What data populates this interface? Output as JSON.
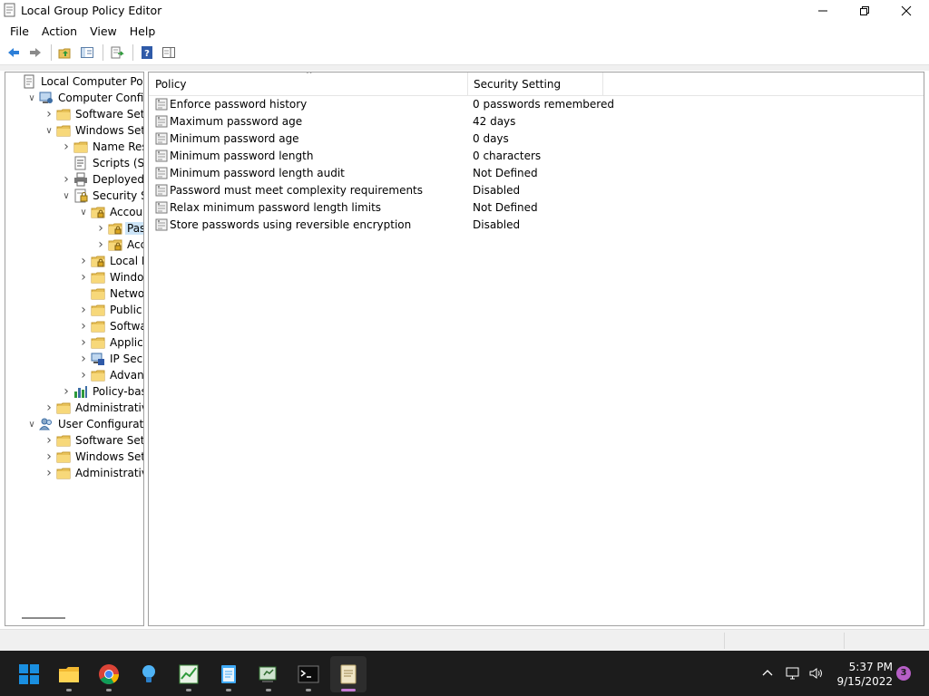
{
  "window": {
    "title": "Local Group Policy Editor",
    "controls": {
      "minimize_icon": "minimize-icon",
      "maximize_icon": "restore-icon",
      "close_icon": "close-icon"
    }
  },
  "menu": [
    "File",
    "Action",
    "View",
    "Help"
  ],
  "toolbar": {
    "buttons": [
      "back-icon",
      "forward-icon",
      "up-folder-icon",
      "show-hide-tree-icon",
      "export-list-icon",
      "help-icon",
      "show-hide-action-pane-icon"
    ]
  },
  "tree": {
    "items": [
      {
        "label": "Local Computer Policy",
        "twisty": "",
        "icon": "policy-doc-icon"
      },
      {
        "label": "Computer Configuration",
        "twisty": "expanded",
        "icon": "computer-icon"
      },
      {
        "label": "Software Settings",
        "twisty": "collapsed",
        "icon": "folder-icon"
      },
      {
        "label": "Windows Settings",
        "twisty": "expanded",
        "icon": "folder-icon"
      },
      {
        "label": "Name Resolution Policy",
        "twisty": "collapsed",
        "icon": "folder-icon"
      },
      {
        "label": "Scripts (Startup/Shutdown)",
        "twisty": "",
        "icon": "scripts-icon"
      },
      {
        "label": "Deployed Printers",
        "twisty": "collapsed",
        "icon": "printer-icon"
      },
      {
        "label": "Security Settings",
        "twisty": "expanded",
        "icon": "security-icon"
      },
      {
        "label": "Account Policies",
        "twisty": "expanded",
        "icon": "lock-folder-icon"
      },
      {
        "label": "Password Policy",
        "twisty": "collapsed",
        "icon": "lock-folder-icon",
        "selected": true
      },
      {
        "label": "Account Lockout Policy",
        "twisty": "collapsed",
        "icon": "lock-folder-icon"
      },
      {
        "label": "Local Policies",
        "twisty": "collapsed",
        "icon": "lock-folder-icon"
      },
      {
        "label": "Windows Defender Firewall",
        "twisty": "collapsed",
        "icon": "folder-icon"
      },
      {
        "label": "Network List Manager Policies",
        "twisty": "",
        "icon": "folder-icon"
      },
      {
        "label": "Public Key Policies",
        "twisty": "collapsed",
        "icon": "folder-icon"
      },
      {
        "label": "Software Restriction Policies",
        "twisty": "collapsed",
        "icon": "folder-icon"
      },
      {
        "label": "Application Control Policies",
        "twisty": "collapsed",
        "icon": "folder-icon"
      },
      {
        "label": "IP Security Policies on Local Computer",
        "twisty": "collapsed",
        "icon": "ip-security-icon"
      },
      {
        "label": "Advanced Audit Policy Configuration",
        "twisty": "collapsed",
        "icon": "folder-icon"
      },
      {
        "label": "Policy-based QoS",
        "twisty": "collapsed",
        "icon": "chart-icon"
      },
      {
        "label": "Administrative Templates",
        "twisty": "collapsed",
        "icon": "folder-icon"
      },
      {
        "label": "User Configuration",
        "twisty": "expanded",
        "icon": "users-icon"
      },
      {
        "label": "Software Settings",
        "twisty": "collapsed",
        "icon": "folder-icon"
      },
      {
        "label": "Windows Settings",
        "twisty": "collapsed",
        "icon": "folder-icon"
      },
      {
        "label": "Administrative Templates",
        "twisty": "collapsed",
        "icon": "folder-icon"
      }
    ]
  },
  "list": {
    "columns": {
      "policy": "Policy",
      "setting": "Security Setting"
    },
    "rows": [
      {
        "policy": "Enforce password history",
        "setting": "0 passwords remembered"
      },
      {
        "policy": "Maximum password age",
        "setting": "42 days"
      },
      {
        "policy": "Minimum password age",
        "setting": "0 days"
      },
      {
        "policy": "Minimum password length",
        "setting": "0 characters"
      },
      {
        "policy": "Minimum password length audit",
        "setting": "Not Defined"
      },
      {
        "policy": "Password must meet complexity requirements",
        "setting": "Disabled"
      },
      {
        "policy": "Relax minimum password length limits",
        "setting": "Not Defined"
      },
      {
        "policy": "Store passwords using reversible encryption",
        "setting": "Disabled"
      }
    ]
  },
  "taskbar": {
    "apps": [
      "start-icon",
      "file-explorer-icon",
      "chrome-icon",
      "tips-icon",
      "task-manager-icon",
      "notepad-icon",
      "group-policy-icon",
      "terminal-icon",
      "notepad-active-icon"
    ],
    "tray_icons": [
      "chevron-up-icon",
      "network-icon",
      "volume-icon"
    ],
    "time": "5:37 PM",
    "date": "9/15/2022",
    "notification_count": "3"
  },
  "colors": {
    "selection": "#cce4f7",
    "taskbar": "#1c1c1c",
    "accent": "#0078d4"
  }
}
